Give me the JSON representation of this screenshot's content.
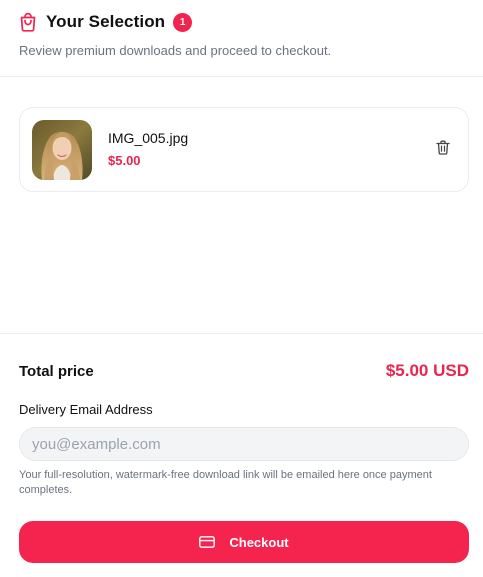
{
  "header": {
    "title": "Your Selection",
    "item_count": "1",
    "subtitle": "Review premium downloads and proceed to checkout.",
    "icon": "shopping-bag-icon"
  },
  "cart": {
    "items": [
      {
        "name": "IMG_005.jpg",
        "price": "$5.00",
        "thumbnail": "portrait-photo",
        "remove_icon": "trash-icon"
      }
    ]
  },
  "summary": {
    "total_label": "Total price",
    "total_value": "$5.00 USD"
  },
  "email": {
    "label": "Delivery Email Address",
    "placeholder": "you@example.com",
    "value": "",
    "helper": "Your full-resolution, watermark-free download link will be emailed here once payment completes."
  },
  "checkout": {
    "label": "Checkout",
    "icon": "credit-card-icon"
  },
  "colors": {
    "accent": "#f5244f",
    "price": "#e8244f",
    "muted_text": "#6b7280"
  }
}
